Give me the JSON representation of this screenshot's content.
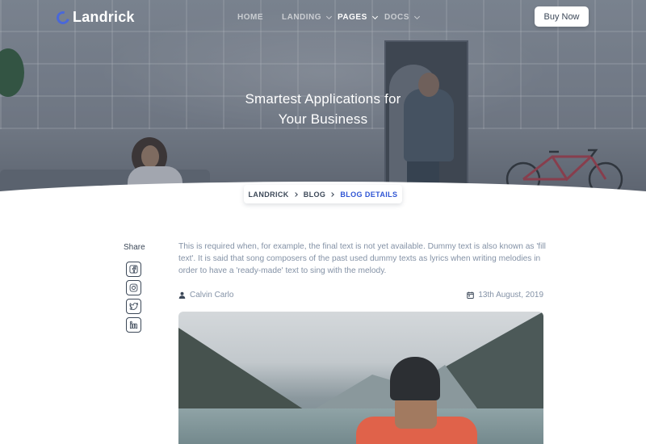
{
  "navbar": {
    "brand": "Landrick",
    "items": [
      {
        "label": "HOME",
        "has_dropdown": false,
        "active": false
      },
      {
        "label": "LANDING",
        "has_dropdown": true,
        "active": false
      },
      {
        "label": "PAGES",
        "has_dropdown": true,
        "active": true
      },
      {
        "label": "DOCS",
        "has_dropdown": true,
        "active": false
      }
    ],
    "buy_button": "Buy Now"
  },
  "hero": {
    "title_line1": "Smartest Applications for",
    "title_line2": "Your Business"
  },
  "breadcrumb": {
    "items": [
      "LANDRICK",
      "BLOG",
      "BLOG DETAILS"
    ]
  },
  "share": {
    "title": "Share",
    "icons": [
      "facebook-icon",
      "instagram-icon",
      "twitter-icon",
      "linkedin-icon"
    ]
  },
  "article": {
    "text": "This is required when, for example, the final text is not yet available. Dummy text is also known as 'fill text'. It is said that song composers of the past used dummy texts as lyrics when writing melodies in order to have a 'ready-made' text to sing with the melody.",
    "author": "Calvin Carlo",
    "date": "13th August, 2019"
  },
  "colors": {
    "primary": "#2f55d4",
    "text_dark": "#3c4858",
    "text_muted": "#8492a6"
  }
}
